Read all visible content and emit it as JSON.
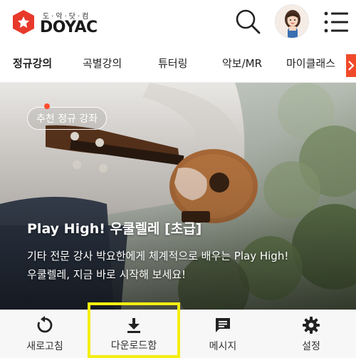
{
  "header": {
    "logo_sub": "도·악·닷·컴",
    "logo_text": "DOYAC",
    "search_icon": "search-icon",
    "avatar_icon": "user-avatar",
    "menu_icon": "hamburger-menu-icon"
  },
  "tabs": [
    {
      "label": "정규강의",
      "active": true
    },
    {
      "label": "곡별강의",
      "active": false
    },
    {
      "label": "튜터링",
      "active": false
    },
    {
      "label": "악보/MR",
      "active": false
    },
    {
      "label": "마이클래스",
      "active": false
    }
  ],
  "tabs_more_icon": "chevron-right-icon",
  "hero": {
    "badge": "추천 정규 강좌",
    "title": "Play High! 우쿨렐레 [초급]",
    "desc_line1": "기타 전문 강사 박요한에게 체계적으로 배우는 Play High!",
    "desc_line2": "우쿨렐레, 지금 바로 시작해 보세요!"
  },
  "bottom_bar": {
    "refresh": {
      "label": "새로고침",
      "icon": "refresh-icon"
    },
    "download": {
      "label": "다운로드함",
      "icon": "download-icon"
    },
    "message": {
      "label": "메시지",
      "icon": "message-icon"
    },
    "settings": {
      "label": "설정",
      "icon": "gear-icon"
    }
  },
  "colors": {
    "brand_red": "#e8392b",
    "tab_arrow": "#f04a2a",
    "highlight": "#f5ee10"
  }
}
